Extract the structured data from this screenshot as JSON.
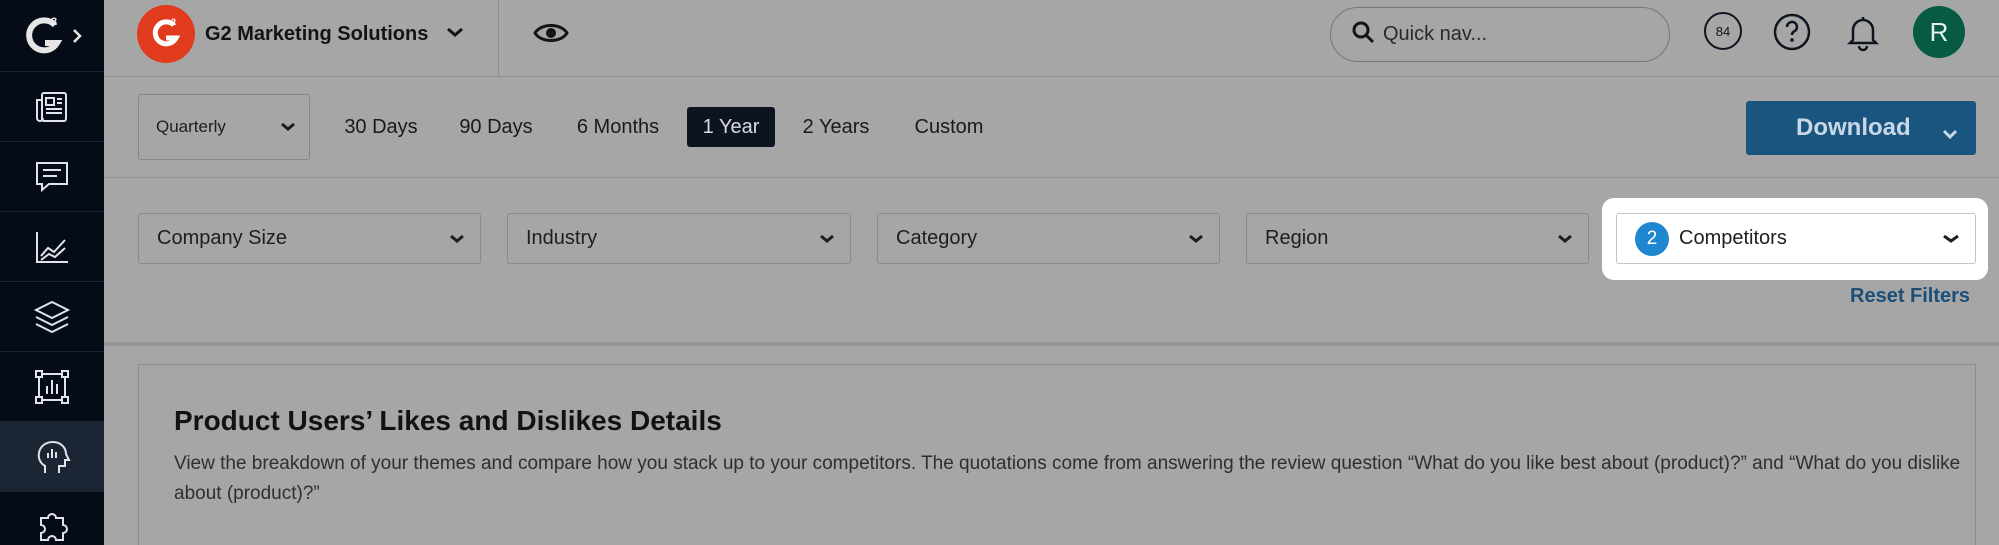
{
  "brand": {
    "name": "G2 Marketing Solutions",
    "logo_text": "G2",
    "color": "#e03b1c"
  },
  "sidebar": {
    "logo_text": "G²",
    "items": [
      {
        "icon": "newspaper-icon"
      },
      {
        "icon": "chat-icon"
      },
      {
        "icon": "line-chart-icon"
      },
      {
        "icon": "layers-icon"
      },
      {
        "icon": "bar-chart-frame-icon"
      },
      {
        "icon": "head-insight-icon",
        "active": true
      },
      {
        "icon": "puzzle-icon"
      }
    ]
  },
  "header": {
    "search_placeholder": "Quick nav...",
    "score_badge": "84",
    "avatar_initial": "R",
    "avatar_color": "#075b42"
  },
  "time_filter": {
    "period": "Quarterly",
    "ranges": [
      "30 Days",
      "90 Days",
      "6 Months",
      "1 Year",
      "2 Years",
      "Custom"
    ],
    "active_range": "1 Year"
  },
  "toolbar": {
    "download_label": "Download",
    "download_color": "#1a5580"
  },
  "filters": {
    "company_size": "Company Size",
    "industry": "Industry",
    "category": "Category",
    "region": "Region",
    "competitors": {
      "count": "2",
      "label": "Competitors"
    },
    "reset_label": "Reset Filters"
  },
  "card": {
    "title": "Product Users’ Likes and Dislikes Details",
    "description": "View the breakdown of your themes and compare how you stack up to your competitors. The quotations come from answering the review question “What do you like best about (product)?” and “What do you dislike about (product)?”"
  }
}
